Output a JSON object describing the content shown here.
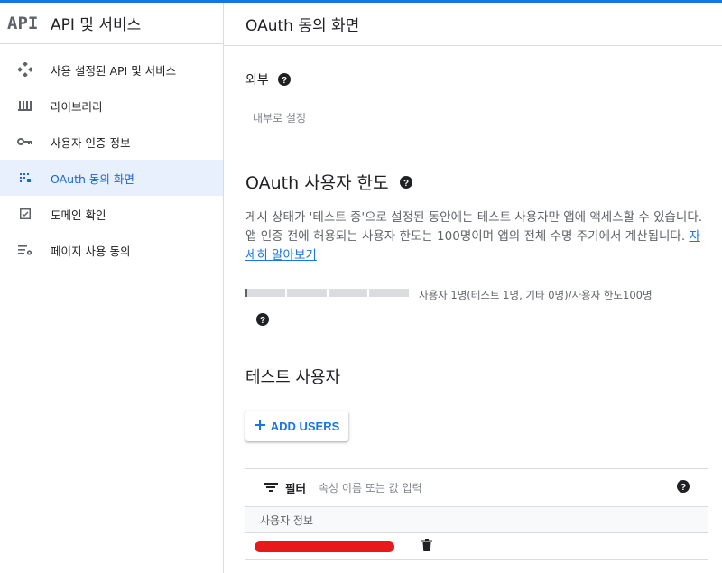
{
  "sidebar": {
    "logo": "API",
    "title": "API 및 서비스",
    "items": [
      {
        "label": "사용 설정된 API 및 서비스",
        "icon": "api-services-icon"
      },
      {
        "label": "라이브러리",
        "icon": "library-icon"
      },
      {
        "label": "사용자 인증 정보",
        "icon": "key-icon"
      },
      {
        "label": "OAuth 동의 화면",
        "icon": "oauth-consent-icon"
      },
      {
        "label": "도메인 확인",
        "icon": "checkbox-icon"
      },
      {
        "label": "페이지 사용 동의",
        "icon": "settings-list-icon"
      }
    ],
    "active_index": 3
  },
  "page": {
    "title": "OAuth 동의 화면",
    "user_type": "외부",
    "make_internal": "내부로 설정"
  },
  "user_cap": {
    "title": "OAuth 사용자 한도",
    "description": "게시 상태가 '테스트 중'으로 설정된 동안에는 테스트 사용자만 앱에 액세스할 수 있습니다. 앱 인증 전에 허용되는 사용자 한도는 100명이며 앱의 전체 수명 주기에서 계산됩니다.",
    "learn_more": "자세히 알아보기",
    "progress_value": 1,
    "progress_max": 100,
    "progress_label": "사용자 1명(테스트 1명, 기타 0명)/사용자 한도100명"
  },
  "test_users": {
    "title": "테스트 사용자",
    "add_button": "ADD USERS",
    "filter_label": "필터",
    "filter_placeholder": "속성 이름 또는 값 입력",
    "column_header": "사용자 정보"
  },
  "colors": {
    "accent": "#1a73e8",
    "active_bg": "#e8f0fe",
    "redaction": "#e8191b"
  }
}
